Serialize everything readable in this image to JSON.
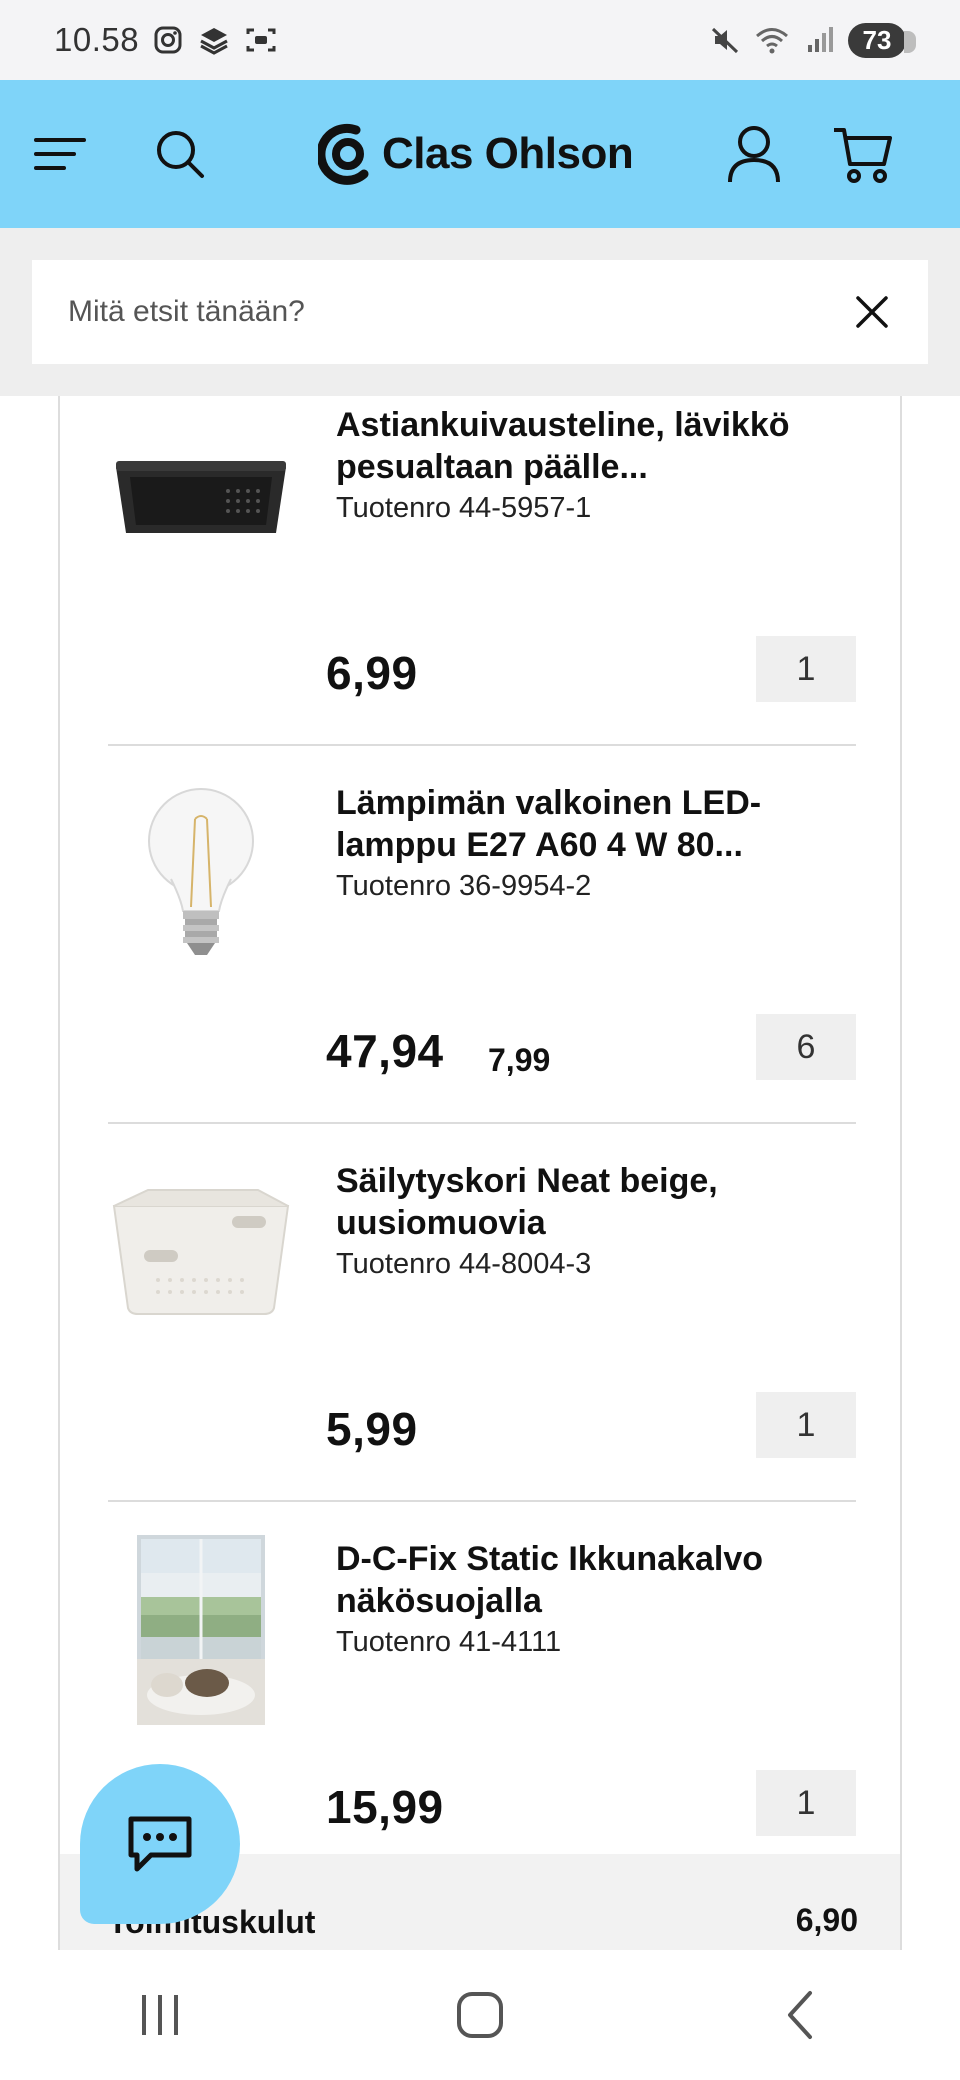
{
  "status_bar": {
    "time": "10.58",
    "battery": "73",
    "icons": [
      "instagram-icon",
      "stack-icon",
      "screenshot-icon",
      "mute-icon",
      "wifi-icon",
      "signal-icon"
    ]
  },
  "header": {
    "brand": "Clas Ohlson",
    "brand_color": "#7fd4f9",
    "icons": [
      "menu-icon",
      "search-icon",
      "account-icon",
      "cart-icon"
    ]
  },
  "search": {
    "placeholder": "Mitä etsit tänään?",
    "value": ""
  },
  "cart": {
    "items": [
      {
        "title": "Astiankuivausteline, lävikkö pesualtaan päälle...",
        "sku": "Tuotenro 44-5957-1",
        "price": "6,99",
        "unit_price": "",
        "qty": "1",
        "image": "dish-rack-image"
      },
      {
        "title": "Lämpimän valkoinen LED-lamppu E27 A60 4 W 80...",
        "sku": "Tuotenro 36-9954-2",
        "price": "47,94",
        "unit_price": "7,99",
        "qty": "6",
        "image": "led-bulb-image"
      },
      {
        "title": "Säilytyskori Neat beige, uusiomuovia",
        "sku": "Tuotenro 44-8004-3",
        "price": "5,99",
        "unit_price": "",
        "qty": "1",
        "image": "storage-basket-image"
      },
      {
        "title": "D-C-Fix Static Ikkunakalvo näkösuojalla",
        "sku": "Tuotenro 41-4111",
        "price": "15,99",
        "unit_price": "",
        "qty": "1",
        "image": "window-film-image"
      }
    ],
    "shipping_label": "Toimituskulut",
    "shipping_value": "6,90"
  },
  "chat": {
    "icon": "chat-icon"
  },
  "nav": {
    "icons": [
      "recent-apps-icon",
      "home-icon",
      "back-icon"
    ]
  }
}
